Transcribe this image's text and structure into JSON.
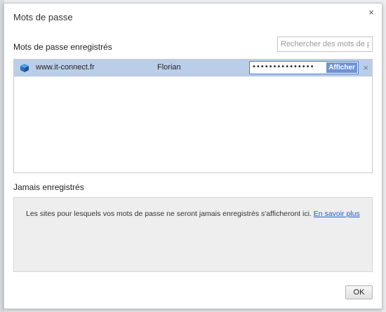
{
  "dialog": {
    "title": "Mots de passe",
    "close_glyph": "×",
    "ok_label": "OK"
  },
  "saved": {
    "heading": "Mots de passe enregistrés",
    "search_placeholder": "Rechercher des mots de pa",
    "rows": [
      {
        "site": "www.it-connect.fr",
        "site_icon": "site-favicon-icon",
        "username": "Florian",
        "password_mask": "•••••••••••••••",
        "show_label": "Afficher",
        "remove_glyph": "×"
      }
    ]
  },
  "never": {
    "heading": "Jamais enregistrés",
    "message": "Les sites pour lesquels vos mots de passe ne seront jamais enregistrés s'afficheront ici.",
    "link": "En savoir plus"
  },
  "colors": {
    "selected_row": "#bbcee9",
    "link": "#1a5bd8",
    "show_button": "#6f93d2"
  }
}
